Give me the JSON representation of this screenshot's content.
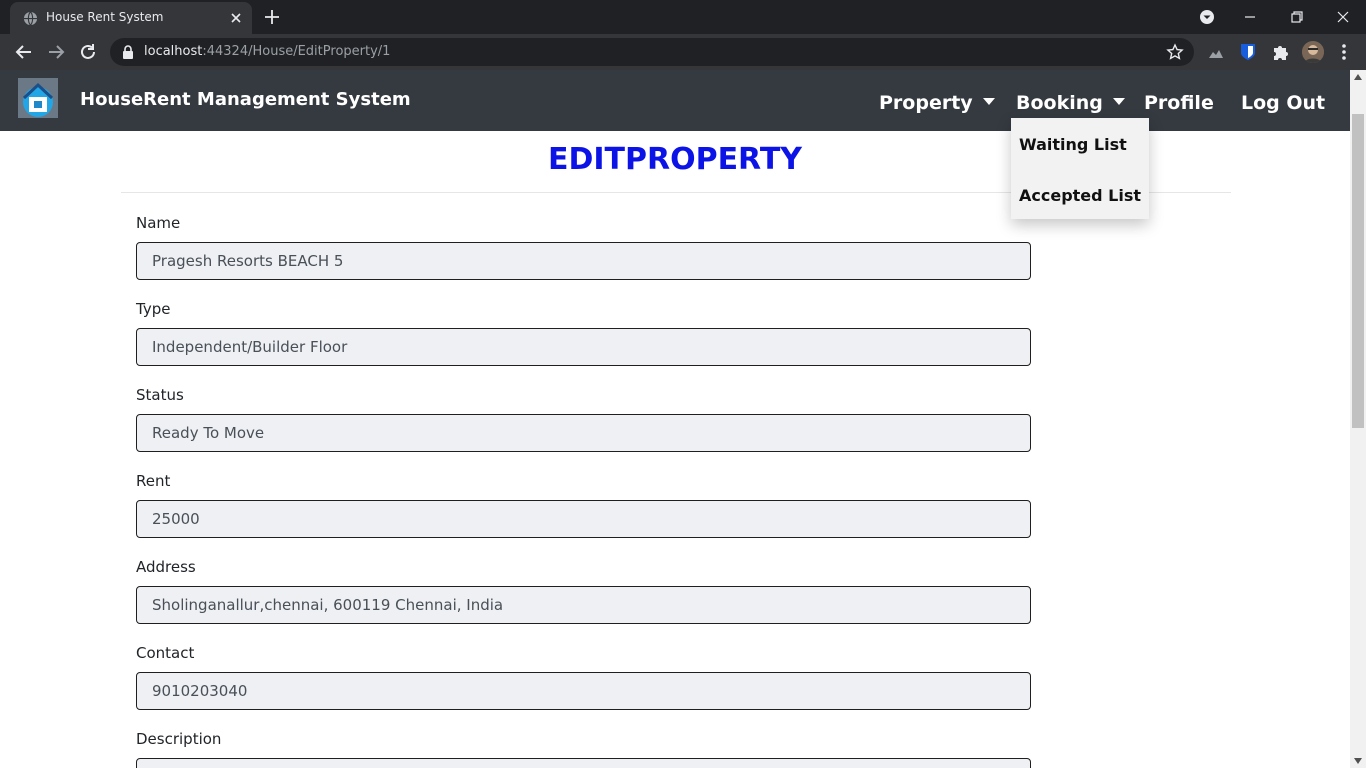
{
  "browser": {
    "tab_title": "House Rent System",
    "url_host": "localhost",
    "url_rest": ":44324/House/EditProperty/1"
  },
  "navbar": {
    "brand": "HouseRent Management System",
    "items": [
      {
        "label": "Property",
        "has_caret": true
      },
      {
        "label": "Booking",
        "has_caret": true
      },
      {
        "label": "Profile"
      },
      {
        "label": "Log Out"
      }
    ]
  },
  "booking_dropdown": {
    "items": [
      "Waiting List",
      "Accepted List"
    ]
  },
  "page": {
    "title": "EDITPROPERTY",
    "title_color": "#0c13e6"
  },
  "form": {
    "fields": [
      {
        "label": "Name",
        "value": "Pragesh Resorts BEACH 5"
      },
      {
        "label": "Type",
        "value": "Independent/Builder Floor"
      },
      {
        "label": "Status",
        "value": "Ready To Move"
      },
      {
        "label": "Rent",
        "value": "25000"
      },
      {
        "label": "Address",
        "value": "Sholinganallur,chennai, 600119 Chennai, India"
      },
      {
        "label": "Contact",
        "value": "9010203040"
      },
      {
        "label": "Description",
        "value": ""
      }
    ]
  },
  "icons": [
    "globe-icon",
    "close-icon",
    "plus-icon",
    "back-arrow-icon",
    "forward-arrow-icon",
    "reload-icon",
    "lock-icon",
    "star-icon",
    "extension-icon",
    "shield-icon",
    "puzzle-icon",
    "profile-avatar",
    "kebab-menu-icon",
    "house-logo"
  ]
}
